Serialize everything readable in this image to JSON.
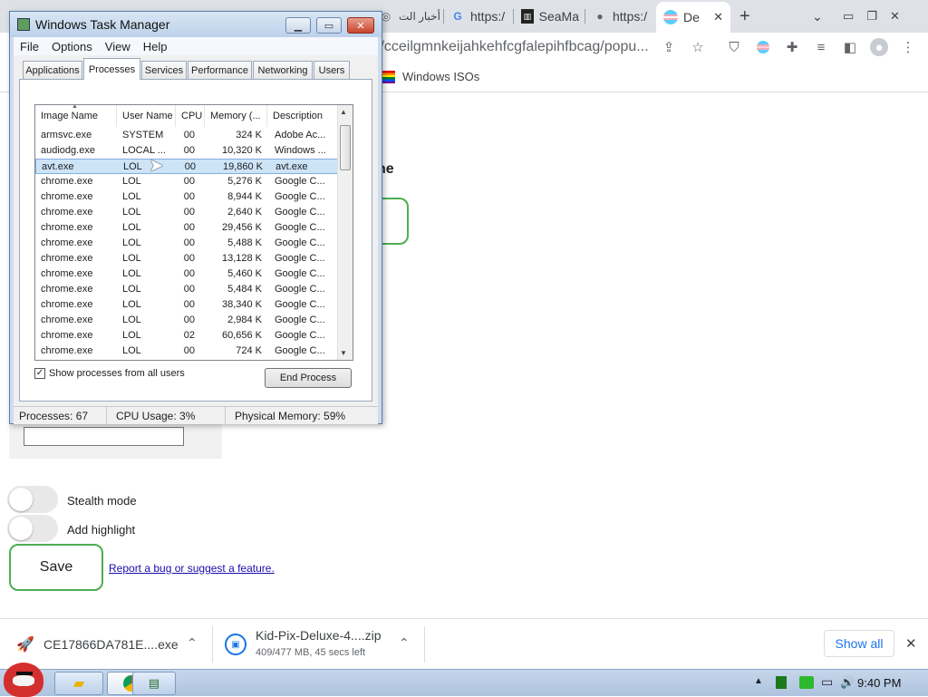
{
  "browser": {
    "tabs": [
      {
        "label": "أخبار الت",
        "icon": "globe-icon"
      },
      {
        "label": "https:/",
        "icon": "google-icon"
      },
      {
        "label": "SeaMa",
        "icon": "museum-icon"
      },
      {
        "label": "https:/",
        "icon": "globe-icon"
      },
      {
        "label": "De",
        "icon": "flag-icon"
      }
    ],
    "new_tab": "+",
    "omnibox_text": "//cceilgmnkeijahkehfcgfalepihfbcag/popu...",
    "bookmark": "Windows ISOs"
  },
  "page": {
    "heading_fragment": "ne",
    "stealth_label": "Stealth mode",
    "highlight_label": "Add highlight",
    "save_label": "Save",
    "report_link": "Report a bug or suggest a feature."
  },
  "downloads": {
    "item1_name": "CE17866DA781E....exe",
    "item2_name": "Kid-Pix-Deluxe-4....zip",
    "item2_status": "409/477 MB, 45 secs left",
    "show_all": "Show all",
    "close": "✕"
  },
  "taskbar": {
    "clock": "9:40 PM"
  },
  "taskmgr": {
    "title": "Windows Task Manager",
    "menu": [
      "File",
      "Options",
      "View",
      "Help"
    ],
    "tabs": [
      "Applications",
      "Processes",
      "Services",
      "Performance",
      "Networking",
      "Users"
    ],
    "columns": [
      "Image Name",
      "User Name",
      "CPU",
      "Memory (...",
      "Description"
    ],
    "rows": [
      [
        "armsvc.exe",
        "SYSTEM",
        "00",
        "324 K",
        "Adobe Ac..."
      ],
      [
        "audiodg.exe",
        "LOCAL ...",
        "00",
        "10,320 K",
        "Windows ..."
      ],
      [
        "avt.exe",
        "LOL",
        "00",
        "19,860 K",
        "avt.exe"
      ],
      [
        "chrome.exe",
        "LOL",
        "00",
        "5,276 K",
        "Google C..."
      ],
      [
        "chrome.exe",
        "LOL",
        "00",
        "8,944 K",
        "Google C..."
      ],
      [
        "chrome.exe",
        "LOL",
        "00",
        "2,640 K",
        "Google C..."
      ],
      [
        "chrome.exe",
        "LOL",
        "00",
        "29,456 K",
        "Google C..."
      ],
      [
        "chrome.exe",
        "LOL",
        "00",
        "5,488 K",
        "Google C..."
      ],
      [
        "chrome.exe",
        "LOL",
        "00",
        "13,128 K",
        "Google C..."
      ],
      [
        "chrome.exe",
        "LOL",
        "00",
        "5,460 K",
        "Google C..."
      ],
      [
        "chrome.exe",
        "LOL",
        "00",
        "5,484 K",
        "Google C..."
      ],
      [
        "chrome.exe",
        "LOL",
        "00",
        "38,340 K",
        "Google C..."
      ],
      [
        "chrome.exe",
        "LOL",
        "00",
        "2,984 K",
        "Google C..."
      ],
      [
        "chrome.exe",
        "LOL",
        "02",
        "60,656 K",
        "Google C..."
      ],
      [
        "chrome.exe",
        "LOL",
        "00",
        "724 K",
        "Google C..."
      ]
    ],
    "selected_row": 2,
    "show_all_label": "Show processes from all users",
    "end_process_label": "End Process",
    "status_processes": "Processes: 67",
    "status_cpu": "CPU Usage: 3%",
    "status_memory": "Physical Memory: 59%"
  }
}
